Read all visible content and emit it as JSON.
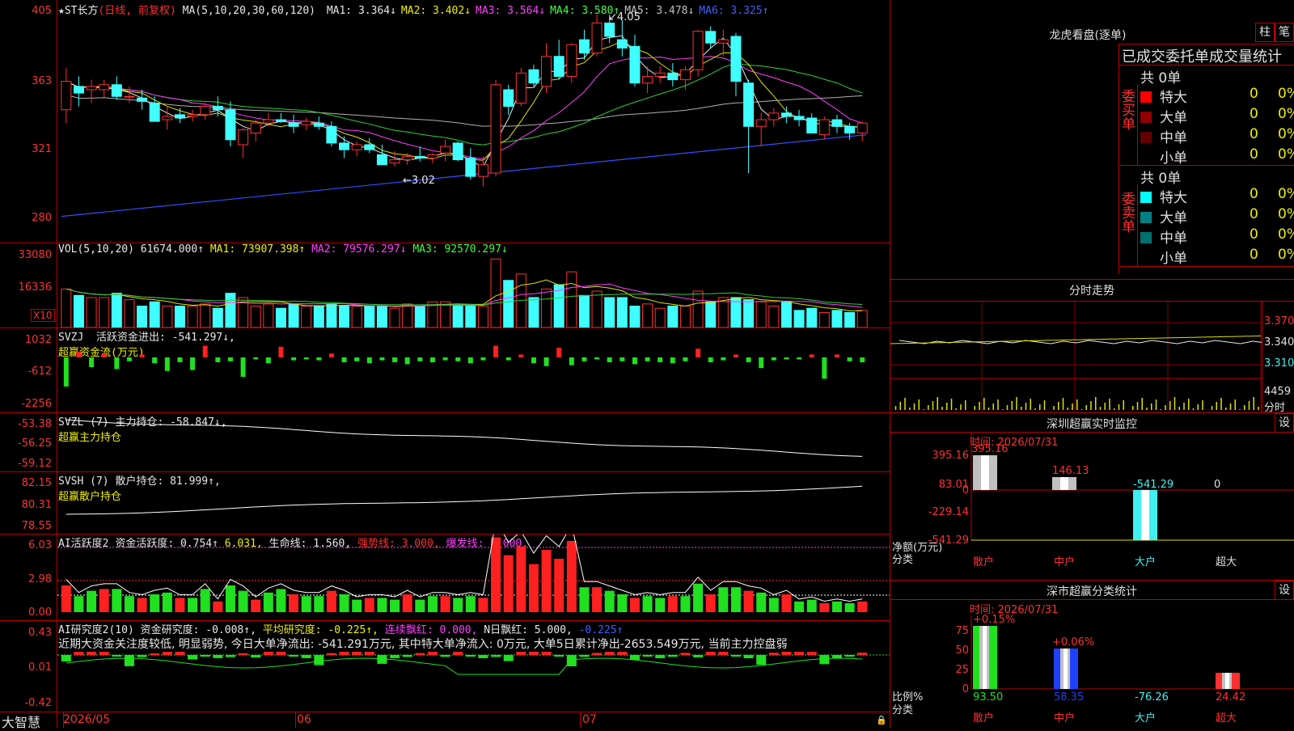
{
  "main_chart": {
    "name": "★ST长方",
    "mode": "(日线, 前复权)",
    "ma_params": "MA(5,10,20,30,60,120)",
    "ma": [
      {
        "label": "MA1:",
        "value": "3.364↓",
        "color": "#e8e8e8"
      },
      {
        "label": "MA2:",
        "value": "3.402↓",
        "color": "#f0f000"
      },
      {
        "label": "MA3:",
        "value": "3.564↓",
        "color": "#ff40ff"
      },
      {
        "label": "MA4:",
        "value": "3.580↑",
        "color": "#40ff40"
      },
      {
        "label": "MA5:",
        "value": "3.478↓",
        "color": "#c0c0c0"
      },
      {
        "label": "MA6:",
        "value": "3.325↑",
        "color": "#4060ff"
      }
    ],
    "y_labels": [
      "405",
      "363",
      "321",
      "280"
    ],
    "high_marker": "4.05",
    "low_marker": "3.02"
  },
  "vol_pane": {
    "title": "VOL(5,10,20)",
    "value": "61674.000↑",
    "ma1": "MA1: 73907.398↑",
    "ma2": "MA2: 79576.297↓",
    "ma3": "MA3: 92570.297↓",
    "y_labels": [
      "33080",
      "16336"
    ],
    "unit": "X10"
  },
  "svzj_pane": {
    "title": "SVZJ",
    "label": "活跃资金进出: -541.297↓,",
    "sub": "超赢资金流(万元)",
    "y_labels": [
      "1032",
      "-612",
      "-2256"
    ]
  },
  "svzl_pane": {
    "title": "SVZL (7)",
    "label": "主力持仓: -58.847↓,",
    "sub": "超赢主力持仓",
    "y_labels": [
      "-53.38",
      "-56.25",
      "-59.12"
    ]
  },
  "svsh_pane": {
    "title": "SVSH (7)",
    "label": "散户持仓: 81.999↑,",
    "sub": "超赢散户持仓",
    "y_labels": [
      "82.15",
      "80.31",
      "78.55"
    ]
  },
  "ai_pane": {
    "title": "AI活跃度2",
    "label": "资金活跃度: 0.754↑",
    "v2": "6.031,",
    "life": "生命线: 1.560,",
    "strong": "强势线: 3.000,",
    "burst": "爆发线: 6.000,",
    "y_labels": [
      "6.03",
      "2.98",
      "0.00"
    ]
  },
  "research_pane": {
    "title": "AI研究度2(10)",
    "label": "资金研究度: -0.008↑,",
    "avg": "平均研究度: -0.225↑,",
    "red": "连续飘红: 0.000,",
    "nred": "N日飘红: 5.000,",
    "last": "-0.225↑",
    "summary": "近期大资金关注度较低, 明显弱势, 今日大单净流出: -541.291万元, 其中特大单净流入: 0万元, 大单5日累计净出-2653.549万元, 当前主力控盘弱",
    "y_labels": [
      "0.43",
      "0.01",
      "-0.42"
    ]
  },
  "x_axis": {
    "start": "2026/05",
    "m2": "06",
    "m3": "07"
  },
  "bottom_brand": "大智慧",
  "right_panel": {
    "dragon_title": "龙虎看盘(逐单)",
    "btn_zhu": "柱",
    "btn_bi": "笔",
    "stats_title": "已成交委托单成交量统计",
    "buy_label": "委买单",
    "sell_label": "委卖单",
    "buy_total": "共 0单",
    "sell_total": "共 0单",
    "buy_rows": [
      {
        "name": "特大",
        "val": "0",
        "pct": "0%",
        "color": "#ff0000"
      },
      {
        "name": "大单",
        "val": "0",
        "pct": "0%",
        "color": "#900000"
      },
      {
        "name": "中单",
        "val": "0",
        "pct": "0%",
        "color": "#600000"
      },
      {
        "name": "小单",
        "val": "0",
        "pct": "0%",
        "color": ""
      }
    ],
    "sell_rows": [
      {
        "name": "特大",
        "val": "0",
        "pct": "0%",
        "color": "#00ffff"
      },
      {
        "name": "大单",
        "val": "0",
        "pct": "0%",
        "color": "#008080"
      },
      {
        "name": "中单",
        "val": "0",
        "pct": "0%",
        "color": "#007070"
      },
      {
        "name": "小单",
        "val": "0",
        "pct": "0%",
        "color": ""
      }
    ],
    "intraday_title": "分时走势",
    "intraday_prices": [
      "3.370",
      "3.340",
      "3.310"
    ],
    "intraday_vol": "4459",
    "intraday_vol_unit": "分时",
    "monitor_title": "深圳超赢实时监控",
    "monitor_btn": "设",
    "monitor_time": "时间: 2026/07/31",
    "monitor_y": [
      "395.16",
      "83.01",
      "0",
      "-229.14",
      "-541.29"
    ],
    "monitor_axis": "净额(万元)",
    "monitor_axis2": "分类",
    "monitor_vals": [
      "395.16",
      "146.13",
      "-541.29",
      "0"
    ],
    "cats": [
      "散户",
      "中户",
      "大户",
      "超大"
    ],
    "class_title": "深市超赢分类统计",
    "class_btn": "设",
    "class_time": "时间: 2026/07/31",
    "class_y": [
      "75",
      "50",
      "25",
      "0"
    ],
    "class_axis": "比例%",
    "class_axis2": "分类",
    "class_top": [
      "+0.15%",
      "+0.06%"
    ],
    "class_vals": [
      "93.50",
      "58.35",
      "-76.26",
      "24.42"
    ]
  },
  "chart_data": {
    "type": "candlestick",
    "dates_label": [
      "2026/05",
      "06",
      "07"
    ],
    "candles": [
      {
        "o": 3.48,
        "h": 3.73,
        "l": 3.4,
        "c": 3.65
      },
      {
        "o": 3.62,
        "h": 3.68,
        "l": 3.5,
        "c": 3.58
      },
      {
        "o": 3.6,
        "h": 3.66,
        "l": 3.52,
        "c": 3.62
      },
      {
        "o": 3.6,
        "h": 3.66,
        "l": 3.55,
        "c": 3.63
      },
      {
        "o": 3.63,
        "h": 3.68,
        "l": 3.54,
        "c": 3.56
      },
      {
        "o": 3.56,
        "h": 3.62,
        "l": 3.52,
        "c": 3.56
      },
      {
        "o": 3.55,
        "h": 3.6,
        "l": 3.48,
        "c": 3.53
      },
      {
        "o": 3.52,
        "h": 3.56,
        "l": 3.44,
        "c": 3.41
      },
      {
        "o": 3.42,
        "h": 3.5,
        "l": 3.36,
        "c": 3.44
      },
      {
        "o": 3.45,
        "h": 3.49,
        "l": 3.4,
        "c": 3.43
      },
      {
        "o": 3.44,
        "h": 3.48,
        "l": 3.41,
        "c": 3.45
      },
      {
        "o": 3.45,
        "h": 3.52,
        "l": 3.42,
        "c": 3.5
      },
      {
        "o": 3.5,
        "h": 3.56,
        "l": 3.44,
        "c": 3.48
      },
      {
        "o": 3.48,
        "h": 3.53,
        "l": 3.26,
        "c": 3.3
      },
      {
        "o": 3.27,
        "h": 3.37,
        "l": 3.19,
        "c": 3.36
      },
      {
        "o": 3.34,
        "h": 3.42,
        "l": 3.29,
        "c": 3.4
      },
      {
        "o": 3.4,
        "h": 3.46,
        "l": 3.38,
        "c": 3.42
      },
      {
        "o": 3.42,
        "h": 3.46,
        "l": 3.4,
        "c": 3.41
      },
      {
        "o": 3.4,
        "h": 3.45,
        "l": 3.34,
        "c": 3.38
      },
      {
        "o": 3.39,
        "h": 3.43,
        "l": 3.36,
        "c": 3.41
      },
      {
        "o": 3.4,
        "h": 3.44,
        "l": 3.36,
        "c": 3.38
      },
      {
        "o": 3.38,
        "h": 3.41,
        "l": 3.26,
        "c": 3.28
      },
      {
        "o": 3.28,
        "h": 3.32,
        "l": 3.19,
        "c": 3.24
      },
      {
        "o": 3.24,
        "h": 3.29,
        "l": 3.2,
        "c": 3.27
      },
      {
        "o": 3.27,
        "h": 3.31,
        "l": 3.22,
        "c": 3.24
      },
      {
        "o": 3.21,
        "h": 3.27,
        "l": 3.15,
        "c": 3.15
      },
      {
        "o": 3.16,
        "h": 3.23,
        "l": 3.14,
        "c": 3.18
      },
      {
        "o": 3.18,
        "h": 3.22,
        "l": 3.15,
        "c": 3.2
      },
      {
        "o": 3.2,
        "h": 3.26,
        "l": 3.17,
        "c": 3.19
      },
      {
        "o": 3.19,
        "h": 3.22,
        "l": 3.16,
        "c": 3.21
      },
      {
        "o": 3.22,
        "h": 3.3,
        "l": 3.17,
        "c": 3.26
      },
      {
        "o": 3.28,
        "h": 3.29,
        "l": 3.17,
        "c": 3.18
      },
      {
        "o": 3.19,
        "h": 3.25,
        "l": 3.06,
        "c": 3.08
      },
      {
        "o": 3.08,
        "h": 3.2,
        "l": 3.02,
        "c": 3.15
      },
      {
        "o": 3.1,
        "h": 3.66,
        "l": 3.08,
        "c": 3.63
      },
      {
        "o": 3.6,
        "h": 3.63,
        "l": 3.45,
        "c": 3.5
      },
      {
        "o": 3.52,
        "h": 3.73,
        "l": 3.5,
        "c": 3.7
      },
      {
        "o": 3.72,
        "h": 3.75,
        "l": 3.62,
        "c": 3.64
      },
      {
        "o": 3.62,
        "h": 3.88,
        "l": 3.58,
        "c": 3.8
      },
      {
        "o": 3.8,
        "h": 3.9,
        "l": 3.66,
        "c": 3.68
      },
      {
        "o": 3.68,
        "h": 3.88,
        "l": 3.64,
        "c": 3.87
      },
      {
        "o": 3.9,
        "h": 3.96,
        "l": 3.78,
        "c": 3.82
      },
      {
        "o": 3.82,
        "h": 4.05,
        "l": 3.8,
        "c": 4.0
      },
      {
        "o": 4.0,
        "h": 4.05,
        "l": 3.88,
        "c": 3.92
      },
      {
        "o": 3.9,
        "h": 4.02,
        "l": 3.8,
        "c": 3.85
      },
      {
        "o": 3.86,
        "h": 3.93,
        "l": 3.62,
        "c": 3.64
      },
      {
        "o": 3.64,
        "h": 3.74,
        "l": 3.58,
        "c": 3.68
      },
      {
        "o": 3.68,
        "h": 3.74,
        "l": 3.64,
        "c": 3.7
      },
      {
        "o": 3.7,
        "h": 3.76,
        "l": 3.62,
        "c": 3.66
      },
      {
        "o": 3.66,
        "h": 3.74,
        "l": 3.6,
        "c": 3.72
      },
      {
        "o": 3.72,
        "h": 3.96,
        "l": 3.68,
        "c": 3.95
      },
      {
        "o": 3.95,
        "h": 3.98,
        "l": 3.85,
        "c": 3.88
      },
      {
        "o": 3.88,
        "h": 3.96,
        "l": 3.8,
        "c": 3.9
      },
      {
        "o": 3.92,
        "h": 3.94,
        "l": 3.56,
        "c": 3.65
      },
      {
        "o": 3.64,
        "h": 3.66,
        "l": 3.1,
        "c": 3.38
      },
      {
        "o": 3.38,
        "h": 3.46,
        "l": 3.26,
        "c": 3.42
      },
      {
        "o": 3.42,
        "h": 3.49,
        "l": 3.38,
        "c": 3.46
      },
      {
        "o": 3.46,
        "h": 3.5,
        "l": 3.4,
        "c": 3.44
      },
      {
        "o": 3.44,
        "h": 3.48,
        "l": 3.38,
        "c": 3.42
      },
      {
        "o": 3.43,
        "h": 3.46,
        "l": 3.34,
        "c": 3.34
      },
      {
        "o": 3.33,
        "h": 3.44,
        "l": 3.3,
        "c": 3.42
      },
      {
        "o": 3.42,
        "h": 3.45,
        "l": 3.34,
        "c": 3.38
      },
      {
        "o": 3.38,
        "h": 3.4,
        "l": 3.3,
        "c": 3.34
      },
      {
        "o": 3.34,
        "h": 3.41,
        "l": 3.29,
        "c": 3.4
      }
    ],
    "volume": [
      1.8,
      1.5,
      1.4,
      1.4,
      1.6,
      1.3,
      1.0,
      1.2,
      1.0,
      1.0,
      1.0,
      1.1,
      0.9,
      1.6,
      1.4,
      1.0,
      1.1,
      0.9,
      1.1,
      1.0,
      1.0,
      1.1,
      1.0,
      1.0,
      1.0,
      1.0,
      0.9,
      1.1,
      1.0,
      1.2,
      1.2,
      1.0,
      1.0,
      1.0,
      3.2,
      2.2,
      2.5,
      1.4,
      1.8,
      2.0,
      2.6,
      1.5,
      1.7,
      1.4,
      1.4,
      1.0,
      1.1,
      0.9,
      1.0,
      1.0,
      1.7,
      1.2,
      1.4,
      1.4,
      1.3,
      1.2,
      1.0,
      1.2,
      0.8,
      0.9,
      0.7,
      0.8,
      0.7,
      0.8
    ]
  }
}
